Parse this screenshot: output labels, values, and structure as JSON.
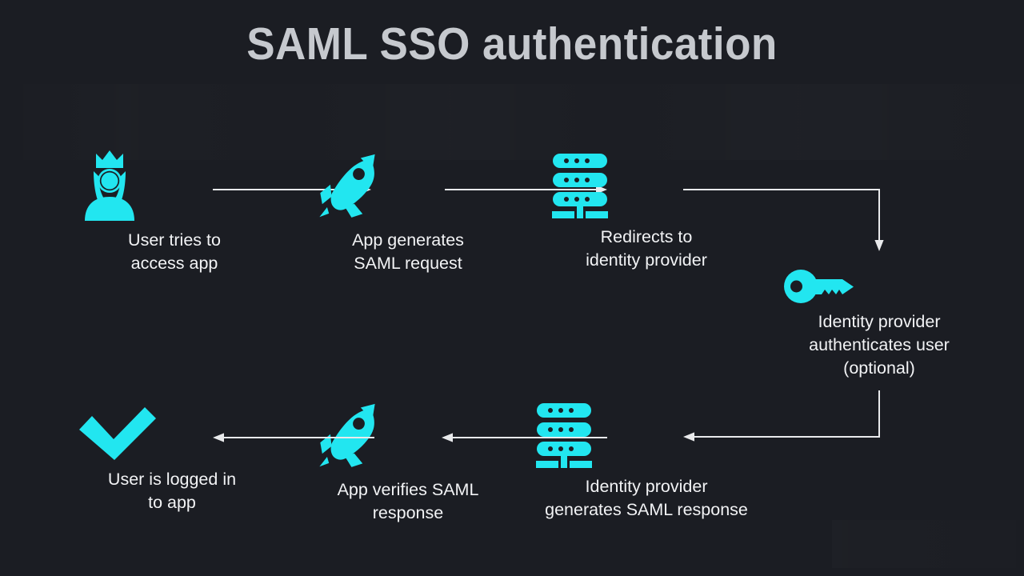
{
  "page": {
    "title": "SAML SSO authentication",
    "background_color": "#1b1d23",
    "accent_color": "#22e6f0",
    "title_color": "#c6c9ce",
    "caption_color": "#f2f3f5",
    "connector_color": "#e9eaec"
  },
  "diagram": {
    "type": "flow",
    "steps": [
      {
        "id": "user-tries-to-access-app",
        "icon": "user-crown-icon",
        "caption": "User tries to\naccess app",
        "row": "top",
        "order": 1
      },
      {
        "id": "app-generates-saml-request",
        "icon": "rocket-icon",
        "caption": "App generates\nSAML request",
        "row": "top",
        "order": 2
      },
      {
        "id": "redirects-to-identity-provider",
        "icon": "server-icon",
        "caption": "Redirects to\nidentity provider",
        "row": "top",
        "order": 3
      },
      {
        "id": "identity-provider-authenticates-user",
        "icon": "key-icon",
        "caption": "Identity provider\nauthenticates user\n(optional)",
        "row": "right",
        "order": 4
      },
      {
        "id": "identity-provider-generates-saml-response",
        "icon": "server-icon",
        "caption": "Identity provider\ngenerates SAML response",
        "row": "bottom",
        "order": 5
      },
      {
        "id": "app-verifies-saml-response",
        "icon": "rocket-icon",
        "caption": "App verifies SAML\nresponse",
        "row": "bottom",
        "order": 6
      },
      {
        "id": "user-is-logged-in-to-app",
        "icon": "checkmark-icon",
        "caption": "User is logged in\nto app",
        "row": "bottom",
        "order": 7
      }
    ],
    "connectors": [
      {
        "id": "arrow-user-to-app",
        "direction": "right"
      },
      {
        "id": "arrow-app-to-idp",
        "direction": "right"
      },
      {
        "id": "arrow-idp-to-key",
        "direction": "elbow-down"
      },
      {
        "id": "arrow-key-to-idp-response",
        "direction": "elbow-left"
      },
      {
        "id": "arrow-idp-response-to-app",
        "direction": "left"
      },
      {
        "id": "arrow-app-to-checkmark",
        "direction": "left"
      }
    ]
  }
}
